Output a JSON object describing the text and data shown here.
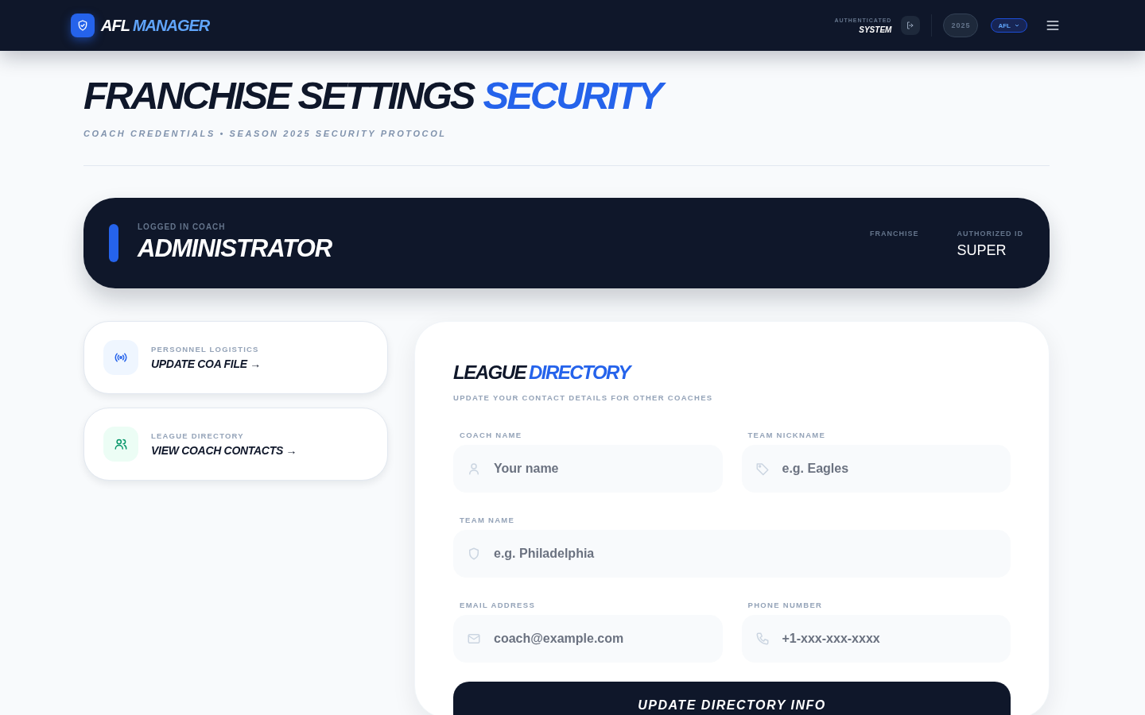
{
  "header": {
    "brand": "AFL",
    "product": "MANAGER",
    "auth_label": "AUTHENTICATED",
    "auth_value": "SYSTEM",
    "season": "2025",
    "league": "AFL"
  },
  "page": {
    "title": "FRANCHISE SETTINGS",
    "title_accent": "SECURITY",
    "subtitle": "COACH CREDENTIALS • SEASON 2025 SECURITY PROTOCOL"
  },
  "coach_banner": {
    "label": "LOGGED IN COACH",
    "name": "ADMINISTRATOR",
    "stats": [
      {
        "label": "FRANCHISE"
      },
      {
        "label": "AUTHORIZED ID",
        "value": "SUPER"
      }
    ]
  },
  "quick_links": [
    {
      "kind": "signal",
      "category": "PERSONNEL LOGISTICS",
      "action": "UPDATE COA FILE →"
    },
    {
      "kind": "users",
      "category": "LEAGUE DIRECTORY",
      "action": "VIEW COACH CONTACTS →"
    }
  ],
  "directory_form": {
    "title": "LEAGUE",
    "title_accent": "DIRECTORY",
    "subtitle": "UPDATE YOUR CONTACT DETAILS FOR OTHER COACHES",
    "rows": [
      [
        {
          "kind": "user",
          "label": "COACH NAME",
          "placeholder": "Your name"
        },
        {
          "kind": "tag",
          "label": "TEAM NICKNAME",
          "placeholder": "e.g. Eagles"
        }
      ],
      [
        {
          "kind": "shield",
          "label": "TEAM NAME",
          "placeholder": "e.g. Philadelphia"
        }
      ],
      [
        {
          "kind": "mail",
          "label": "EMAIL ADDRESS",
          "placeholder": "coach@example.com"
        },
        {
          "kind": "phone",
          "label": "PHONE NUMBER",
          "placeholder": "+1-xxx-xxx-xxxx"
        }
      ]
    ],
    "submit": "UPDATE DIRECTORY INFO"
  }
}
